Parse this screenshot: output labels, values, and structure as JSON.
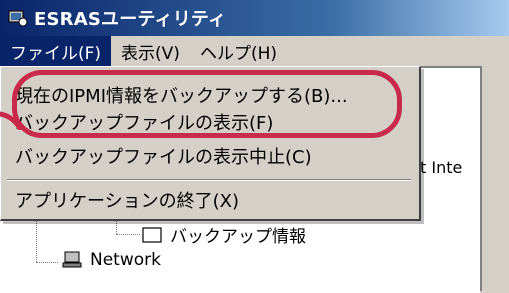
{
  "window": {
    "title": "ESRASユーティリティ"
  },
  "menubar": {
    "items": [
      {
        "label": "ファイル(F)"
      },
      {
        "label": "表示(V)"
      },
      {
        "label": "ヘルプ(H)"
      }
    ]
  },
  "file_menu": {
    "items": [
      {
        "label": "現在のIPMI情報をバックアップする(B)..."
      },
      {
        "label": "バックアップファイルの表示(F)"
      },
      {
        "label": "バックアップファイルの表示中止(C)"
      },
      {
        "label": "アプリケーションの終了(X)"
      }
    ]
  },
  "tree": {
    "backup_info": "バックアップ情報",
    "network": "Network"
  },
  "right_pane": {
    "truncated_text": "ent Inte"
  },
  "colors": {
    "highlight": "#c92a4b",
    "menu_active": "#0a246a"
  },
  "icons": [
    "app-icon",
    "folder-icon",
    "network-icon"
  ]
}
